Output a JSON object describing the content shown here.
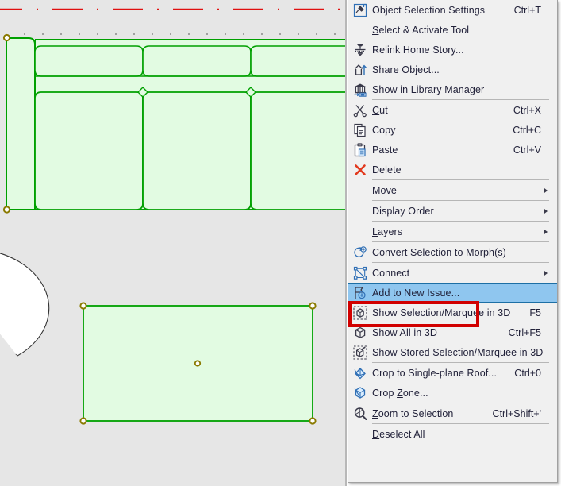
{
  "app": {
    "type": "cad-context-menu",
    "canvas_bg": "#e6e6e6",
    "menu_bg": "#f0f0f0",
    "highlight_color": "#8fc6ef",
    "highlight_border": "#1d6fa5",
    "annotation_color": "#d10000",
    "element_stroke": "#00a000",
    "element_fill": "#e2fbe2",
    "hotspot_color": "#8a7a00",
    "grid_dot_color": "#808080",
    "axis_line_color": "#e01010"
  },
  "drawing": {
    "name": "floor-plan-selection",
    "objects": [
      {
        "name": "sofa-sectional",
        "type": "furniture-plan",
        "selected": true
      },
      {
        "name": "rectangle-zone",
        "type": "rectangle",
        "selected": true
      },
      {
        "name": "arc-wall",
        "type": "arc",
        "selected": false
      }
    ]
  },
  "menu": {
    "name": "object-context-menu",
    "items": [
      {
        "label": "Object Selection Settings",
        "shortcut": "Ctrl+T",
        "icon": "object-settings-icon",
        "submenu": false,
        "separator_after": false,
        "accel": null
      },
      {
        "label": "Select & Activate Tool",
        "shortcut": "",
        "icon": null,
        "submenu": false,
        "separator_after": false,
        "accel": "S"
      },
      {
        "label": "Relink Home Story...",
        "shortcut": "",
        "icon": "relink-home-story-icon",
        "submenu": false,
        "separator_after": false,
        "accel": null
      },
      {
        "label": "Share Object...",
        "shortcut": "",
        "icon": "share-object-icon",
        "submenu": false,
        "separator_after": false,
        "accel": null
      },
      {
        "label": "Show in Library Manager",
        "shortcut": "",
        "icon": "library-manager-icon",
        "submenu": false,
        "separator_after": true,
        "accel": null
      },
      {
        "label": "Cut",
        "shortcut": "Ctrl+X",
        "icon": "scissors-icon",
        "submenu": false,
        "separator_after": false,
        "accel": "C"
      },
      {
        "label": "Copy",
        "shortcut": "Ctrl+C",
        "icon": "copy-icon",
        "submenu": false,
        "separator_after": false,
        "accel": null
      },
      {
        "label": "Paste",
        "shortcut": "Ctrl+V",
        "icon": "paste-icon",
        "submenu": false,
        "separator_after": false,
        "accel": null
      },
      {
        "label": "Delete",
        "shortcut": "",
        "icon": "delete-x-icon",
        "submenu": false,
        "separator_after": true,
        "accel": null
      },
      {
        "label": "Move",
        "shortcut": "",
        "icon": null,
        "submenu": true,
        "separator_after": true,
        "accel": null
      },
      {
        "label": "Display Order",
        "shortcut": "",
        "icon": null,
        "submenu": true,
        "separator_after": true,
        "accel": null
      },
      {
        "label": "Layers",
        "shortcut": "",
        "icon": null,
        "submenu": true,
        "separator_after": true,
        "accel": "L"
      },
      {
        "label": "Convert Selection to Morph(s)",
        "shortcut": "",
        "icon": "convert-to-morph-icon",
        "submenu": false,
        "separator_after": true,
        "accel": null
      },
      {
        "label": "Connect",
        "shortcut": "",
        "icon": "connect-icon",
        "submenu": true,
        "separator_after": false,
        "accel": null
      },
      {
        "label": "Add to New Issue...",
        "shortcut": "",
        "icon": "add-to-new-issue-icon",
        "submenu": false,
        "separator_after": false,
        "accel": null,
        "selected": true,
        "annotated": true
      },
      {
        "label": "Show Selection/Marquee in 3D",
        "shortcut": "F5",
        "icon": "show-selection-3d-icon",
        "submenu": false,
        "separator_after": false,
        "accel": null
      },
      {
        "label": "Show All in 3D",
        "shortcut": "Ctrl+F5",
        "icon": "show-all-3d-icon",
        "submenu": false,
        "separator_after": false,
        "accel": null
      },
      {
        "label": "Show Stored Selection/Marquee in 3D",
        "shortcut": "",
        "icon": "show-stored-selection-3d-icon",
        "submenu": false,
        "separator_after": true,
        "accel": null
      },
      {
        "label": "Crop to Single-plane Roof...",
        "shortcut": "Ctrl+0",
        "icon": "crop-roof-icon",
        "submenu": false,
        "separator_after": false,
        "accel": null
      },
      {
        "label": "Crop Zone...",
        "shortcut": "",
        "icon": "crop-zone-icon",
        "submenu": false,
        "separator_after": true,
        "accel": "Z"
      },
      {
        "label": "Zoom to Selection",
        "shortcut": "Ctrl+Shift+'",
        "icon": "zoom-to-selection-icon",
        "submenu": false,
        "separator_after": true,
        "accel": "Z"
      },
      {
        "label": "Deselect All",
        "shortcut": "",
        "icon": null,
        "submenu": false,
        "separator_after": false,
        "accel": "D"
      }
    ]
  }
}
